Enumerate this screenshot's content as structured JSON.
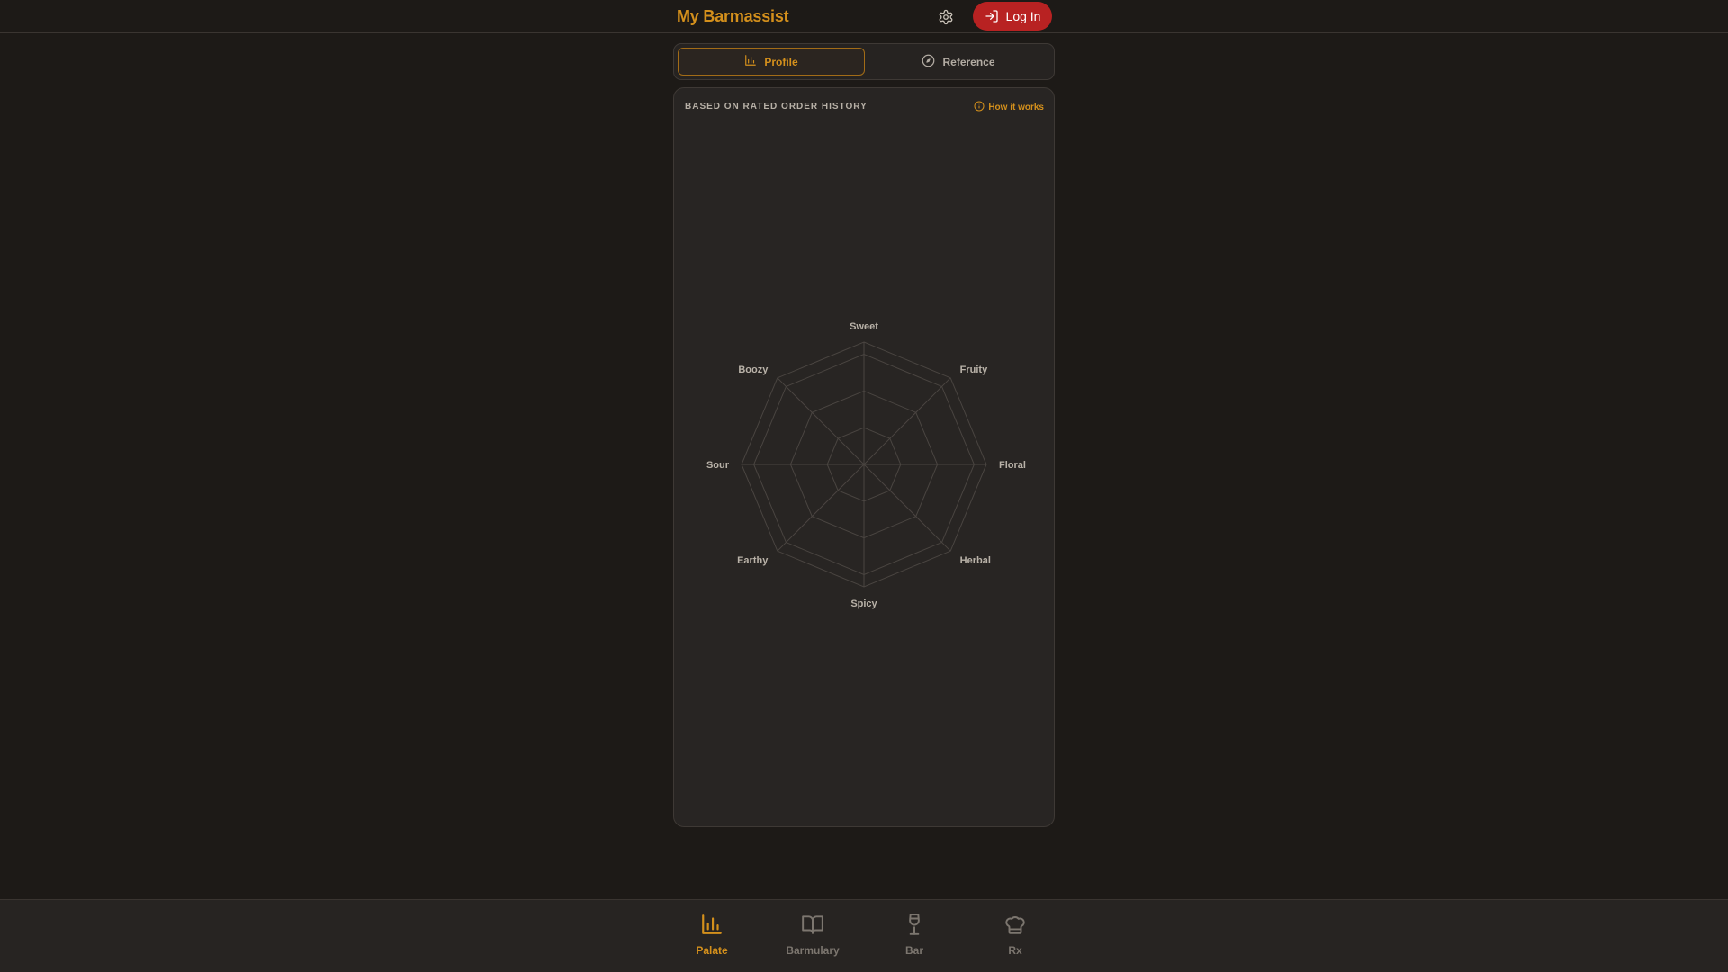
{
  "header": {
    "brand": "My Barmassist",
    "settings_icon": "gear-icon",
    "login_label": "Log In",
    "login_icon": "log-in-icon"
  },
  "tabs": [
    {
      "label": "Profile",
      "icon": "bar-chart-icon",
      "active": true
    },
    {
      "label": "Reference",
      "icon": "compass-icon",
      "active": false
    }
  ],
  "card": {
    "title": "BASED ON RATED ORDER HISTORY",
    "how_label": "How it works",
    "how_icon": "info-icon"
  },
  "chart_data": {
    "type": "radar",
    "axes": [
      "Sweet",
      "Fruity",
      "Floral",
      "Herbal",
      "Spicy",
      "Earthy",
      "Sour",
      "Boozy"
    ],
    "series": [],
    "grid": true
  },
  "bottom_nav": [
    {
      "label": "Palate",
      "icon": "bar-chart-icon",
      "active": true
    },
    {
      "label": "Barmulary",
      "icon": "book-open-icon",
      "active": false
    },
    {
      "label": "Bar",
      "icon": "wine-glass-icon",
      "active": false
    },
    {
      "label": "Rx",
      "icon": "chef-hat-icon",
      "active": false
    }
  ],
  "colors": {
    "accent": "#d4901c",
    "login": "#b82222",
    "background": "#1d1a17",
    "card": "#282523"
  }
}
